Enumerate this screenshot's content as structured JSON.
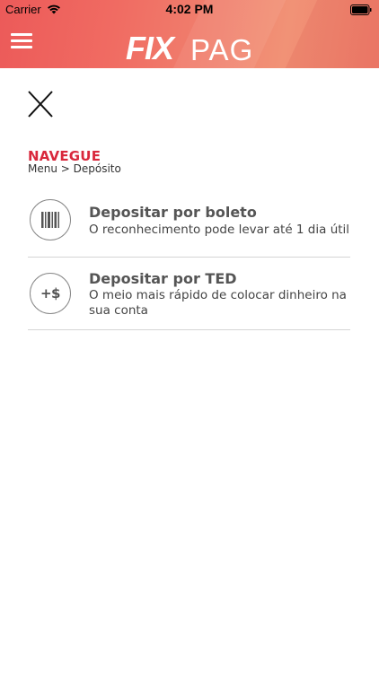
{
  "status_bar": {
    "carrier": "Carrier",
    "time": "4:02 PM"
  },
  "header": {
    "logo_part1": "FIX",
    "logo_part2": "PAG",
    "menu_icon": "hamburger-icon",
    "accent_color": "#ec5a59"
  },
  "close": {
    "icon": "close-icon"
  },
  "navigation": {
    "title": "NAVEGUE",
    "title_color": "#d9283c",
    "breadcrumb": "Menu > Depósito"
  },
  "options": [
    {
      "icon": "barcode-icon",
      "title": "Depositar por boleto",
      "description": "O reconhecimento pode levar até 1 dia útil"
    },
    {
      "icon": "plus-dollar-icon",
      "icon_text": "+$",
      "title": "Depositar por TED",
      "description": "O meio mais rápido de colocar dinheiro na sua conta"
    }
  ]
}
